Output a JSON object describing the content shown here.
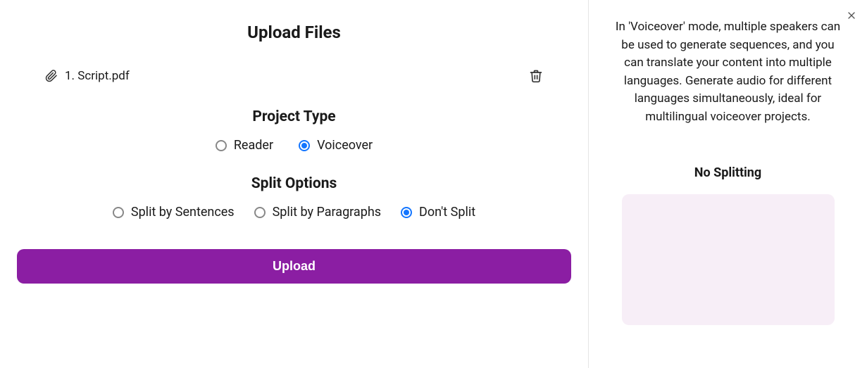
{
  "main": {
    "title": "Upload Files",
    "file": {
      "index": "1.",
      "name": "Script.pdf"
    },
    "projectType": {
      "heading": "Project Type",
      "options": {
        "reader": "Reader",
        "voiceover": "Voiceover"
      },
      "selected": "voiceover"
    },
    "splitOptions": {
      "heading": "Split Options",
      "options": {
        "sentences": "Split by Sentences",
        "paragraphs": "Split by Paragraphs",
        "none": "Don't Split"
      },
      "selected": "none"
    },
    "uploadButton": "Upload"
  },
  "side": {
    "infoText": "In 'Voiceover' mode, multiple speakers can be used to generate sequences, and you can translate your content into multiple languages. Generate audio for different languages simultaneously, ideal for multilingual voiceover projects.",
    "heading": "No Splitting"
  }
}
